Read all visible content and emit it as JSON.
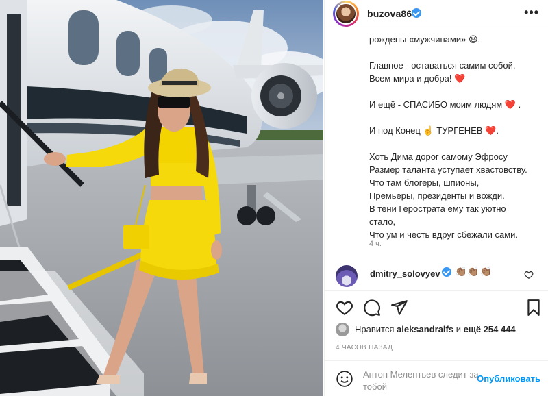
{
  "post": {
    "username": "buzova86",
    "more_label": "•••",
    "caption_lines": [
      "рождены «мужчинами» 😆.",
      "",
      "Главное - оставаться самим собой.",
      "Всем мира и добра! ❤️",
      "",
      "И ещё - СПАСИБО моим людям ❤️ .",
      "",
      "И под Конец ☝️ ТУРГЕНЕВ ❤️.",
      "",
      "Хоть Дима дорог самому Эфросу",
      "Размер таланта уступает хвастовству.",
      "Что там блогеры, шпионы,",
      "Премьеры, президенты и вожди.",
      "В тени Герострата ему так уютно",
      "стало,",
      "Что ум и честь вдруг сбежали сами."
    ],
    "caption_time": "4 ч.",
    "comment": {
      "username": "dmitry_solovyev",
      "text": "👏🏽👏🏽👏🏽"
    },
    "likes": {
      "prefix": "Нравится",
      "user": "aleksandralfs",
      "middle": "и",
      "count": "ещё 254 444"
    },
    "posted": "4 ЧАСОВ НАЗАД",
    "comment_box": {
      "placeholder": "Антон Мелентьев следит за тобой",
      "publish_label": "Опубликовать"
    }
  },
  "icons": {
    "header": [
      "avatar",
      "verified-badge-icon",
      "more-icon"
    ],
    "actions": [
      "heart-icon",
      "comment-icon",
      "share-icon",
      "bookmark-icon"
    ],
    "comment_box": [
      "smiley-icon"
    ]
  },
  "colors": {
    "accent": "#0095f6",
    "verified": "#3897f0",
    "heart": "#ed1c24",
    "muted": "#8e8e8e",
    "dress": "#f5d90a"
  }
}
